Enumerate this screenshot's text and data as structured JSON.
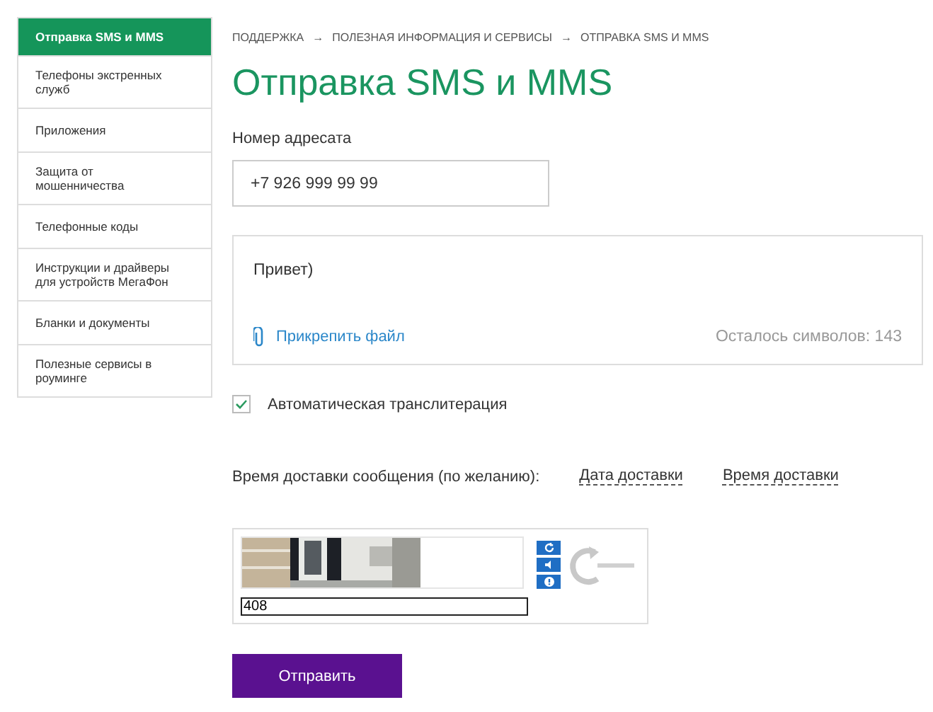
{
  "sidebar": {
    "items": [
      {
        "label": "Отправка SMS и MMS",
        "selected": true
      },
      {
        "label": "Телефоны экстренных служб",
        "selected": false
      },
      {
        "label": "Приложения",
        "selected": false
      },
      {
        "label": "Защита от мошенничества",
        "selected": false
      },
      {
        "label": "Телефонные коды",
        "selected": false
      },
      {
        "label": "Инструкции и драйверы для устройств МегаФон",
        "selected": false
      },
      {
        "label": "Бланки и документы",
        "selected": false
      },
      {
        "label": "Полезные сервисы в роуминге",
        "selected": false
      }
    ]
  },
  "breadcrumbs": [
    "ПОДДЕРЖКА",
    "ПОЛЕЗНАЯ ИНФОРМАЦИЯ И СЕРВИСЫ",
    "ОТПРАВКА SMS И MMS"
  ],
  "breadcrumb_separator": "→",
  "title": "Отправка SMS и MMS",
  "recipient": {
    "label": "Номер адресата",
    "value": "+7 926 999 99 99"
  },
  "message": {
    "value": "Привет)",
    "attach_link": "Прикрепить файл",
    "counter": "Осталось символов: 143"
  },
  "transliteration": {
    "label": "Автоматическая транслитерация",
    "checked": true
  },
  "delivery": {
    "label": "Время доставки сообщения (по желанию):",
    "date_link": "Дата доставки",
    "time_link": "Время доставки"
  },
  "captcha": {
    "value": "408"
  },
  "submit": "Отправить"
}
